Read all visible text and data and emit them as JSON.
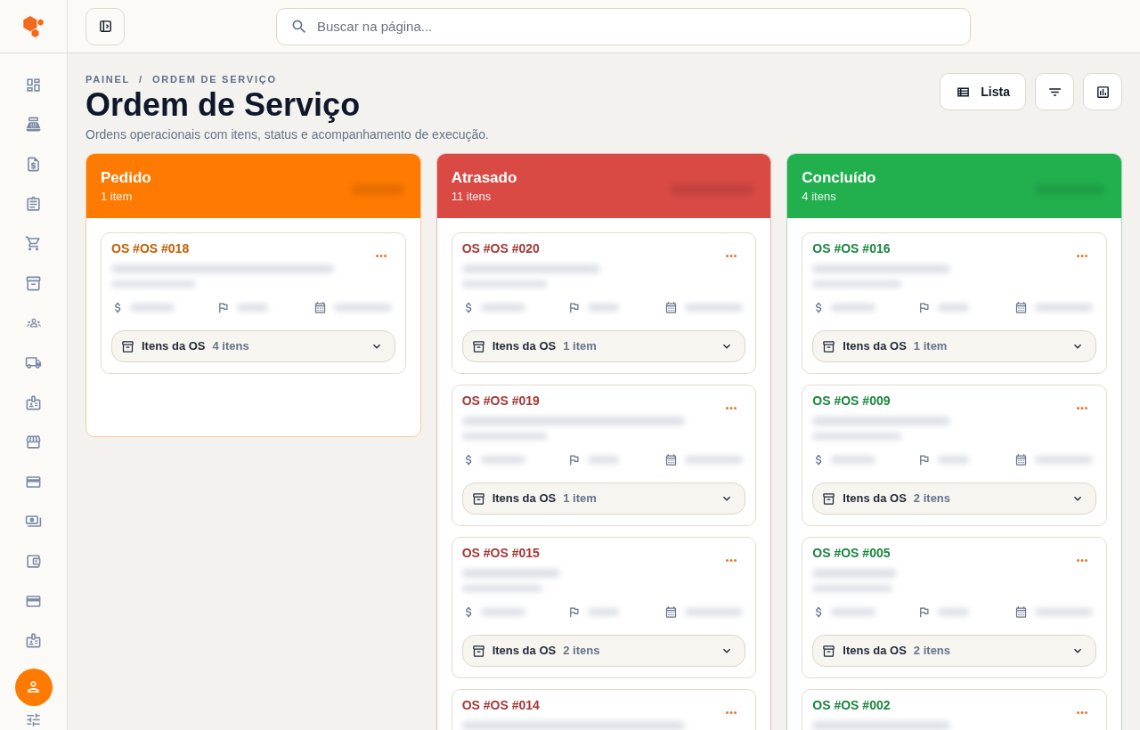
{
  "sidebar": {
    "items": [
      {
        "selected": false
      },
      {
        "selected": false
      },
      {
        "selected": false
      },
      {
        "selected": false
      },
      {
        "selected": false
      },
      {
        "selected": false
      },
      {
        "selected": false
      },
      {
        "selected": false
      },
      {
        "selected": false
      },
      {
        "selected": false
      },
      {
        "selected": false
      },
      {
        "selected": false
      },
      {
        "selected": false
      },
      {
        "selected": false
      },
      {
        "selected": false
      },
      {
        "selected": true
      },
      {
        "selected": false
      }
    ]
  },
  "topbar": {
    "search": {
      "placeholder": "Buscar na página..."
    }
  },
  "page": {
    "breadcrumb": {
      "items": [
        "PAINEL",
        "ORDEM DE SERVIÇO"
      ],
      "separator": "/"
    },
    "title": "Ordem de Serviço",
    "subtitle": "Ordens operacionais com itens, status e acompanhamento de execução."
  },
  "toolbar": {
    "view_button": {
      "label": "Lista"
    }
  },
  "columns": [
    {
      "title": "Pedido",
      "count": "1 item",
      "color": "#ff7a00",
      "cards": [
        {
          "number": "OS #OS #018",
          "items_label": "Itens da OS",
          "items_count": "4 itens",
          "expanded": false
        }
      ]
    },
    {
      "title": "Atrasado",
      "count": "11 itens",
      "color": "#d94a45",
      "cards": [
        {
          "number": "OS #OS #020",
          "items_label": "Itens da OS",
          "items_count": "1 item",
          "expanded": false
        },
        {
          "number": "OS #OS #019",
          "items_label": "Itens da OS",
          "items_count": "1 item",
          "expanded": false
        },
        {
          "number": "OS #OS #015",
          "items_label": "Itens da OS",
          "items_count": "2 itens",
          "expanded": false
        },
        {
          "number": "OS #OS #014"
        }
      ]
    },
    {
      "title": "Concluído",
      "count": "4 itens",
      "color": "#22b04f",
      "cards": [
        {
          "number": "OS #OS #016",
          "items_label": "Itens da OS",
          "items_count": "1 item",
          "expanded": false
        },
        {
          "number": "OS #OS #009",
          "items_label": "Itens da OS",
          "items_count": "2 itens",
          "expanded": false
        },
        {
          "number": "OS #OS #005",
          "items_label": "Itens da OS",
          "items_count": "2 itens",
          "expanded": false
        },
        {
          "number": "OS #OS #002"
        }
      ]
    }
  ]
}
